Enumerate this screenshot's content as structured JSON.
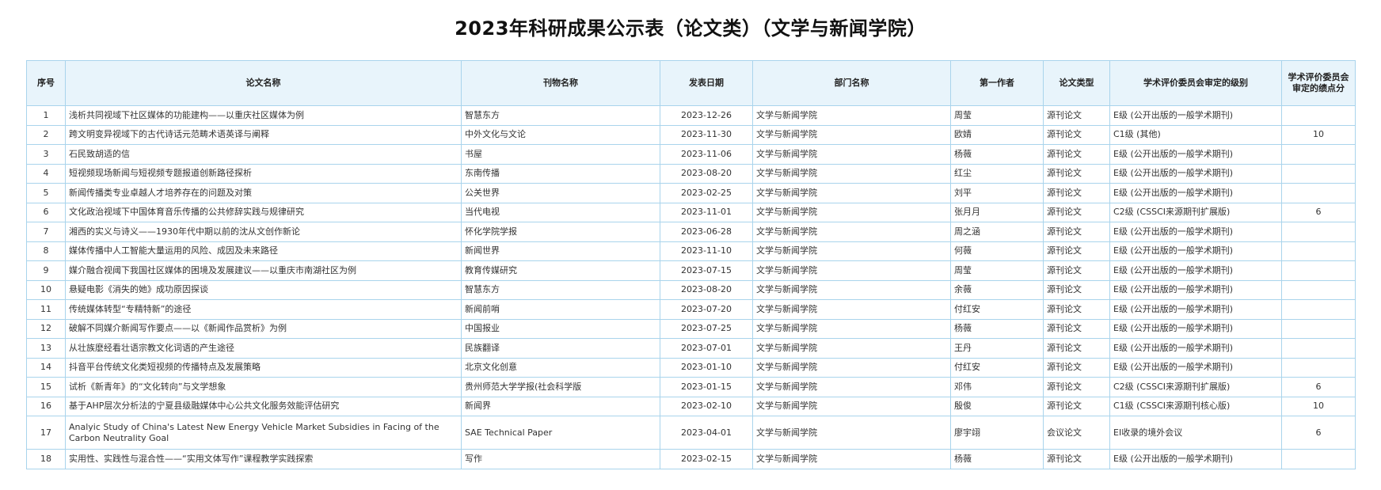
{
  "title": "2023年科研成果公示表（论文类）（文学与新闻学院）",
  "headers": [
    "序号",
    "论文名称",
    "刊物名称",
    "发表日期",
    "部门名称",
    "第一作者",
    "论文类型",
    "学术评价委员会审定的级别",
    "学术评价委员会审定的绩点分"
  ],
  "rows": [
    {
      "no": "1",
      "name": "浅析共同视域下社区媒体的功能建构——以重庆社区媒体为例",
      "journal": "智慧东方",
      "date": "2023-12-26",
      "dept": "文学与新闻学院",
      "author": "周莹",
      "type": "源刊论文",
      "level": "E级 (公开出版的一般学术期刊)",
      "score": ""
    },
    {
      "no": "2",
      "name": "跨文明变异视域下的古代诗话元范畴术语英译与阐释",
      "journal": "中外文化与文论",
      "date": "2023-11-30",
      "dept": "文学与新闻学院",
      "author": "欧婧",
      "type": "源刊论文",
      "level": "C1级 (其他)",
      "score": "10"
    },
    {
      "no": "3",
      "name": "石民致胡适的信",
      "journal": "书屋",
      "date": "2023-11-06",
      "dept": "文学与新闻学院",
      "author": "杨薇",
      "type": "源刊论文",
      "level": "E级 (公开出版的一般学术期刊)",
      "score": ""
    },
    {
      "no": "4",
      "name": "短视频现场新闻与短视频专题报道创新路径探析",
      "journal": "东南传播",
      "date": "2023-08-20",
      "dept": "文学与新闻学院",
      "author": "红尘",
      "type": "源刊论文",
      "level": "E级 (公开出版的一般学术期刊)",
      "score": ""
    },
    {
      "no": "5",
      "name": "新闻传播类专业卓越人才培养存在的问题及对策",
      "journal": "公关世界",
      "date": "2023-02-25",
      "dept": "文学与新闻学院",
      "author": "刘平",
      "type": "源刊论文",
      "level": "E级 (公开出版的一般学术期刊)",
      "score": ""
    },
    {
      "no": "6",
      "name": "文化政治视域下中国体育音乐传播的公共修辞实践与规律研究",
      "journal": "当代电视",
      "date": "2023-11-01",
      "dept": "文学与新闻学院",
      "author": "张月月",
      "type": "源刊论文",
      "level": "C2级 (CSSCI来源期刊扩展版)",
      "score": "6"
    },
    {
      "no": "7",
      "name": "湘西的实义与诗义——1930年代中期以前的沈从文创作新论",
      "journal": "怀化学院学报",
      "date": "2023-06-28",
      "dept": "文学与新闻学院",
      "author": "周之涵",
      "type": "源刊论文",
      "level": "E级 (公开出版的一般学术期刊)",
      "score": ""
    },
    {
      "no": "8",
      "name": "媒体传播中人工智能大量运用的风险、成因及未来路径",
      "journal": "新闻世界",
      "date": "2023-11-10",
      "dept": "文学与新闻学院",
      "author": "何薇",
      "type": "源刊论文",
      "level": "E级 (公开出版的一般学术期刊)",
      "score": ""
    },
    {
      "no": "9",
      "name": "媒介融合视阈下我国社区媒体的困境及发展建议——以重庆市南湖社区为例",
      "journal": "教育传媒研究",
      "date": "2023-07-15",
      "dept": "文学与新闻学院",
      "author": "周莹",
      "type": "源刊论文",
      "level": "E级 (公开出版的一般学术期刊)",
      "score": ""
    },
    {
      "no": "10",
      "name": "悬疑电影《消失的她》成功原因探谈",
      "journal": "智慧东方",
      "date": "2023-08-20",
      "dept": "文学与新闻学院",
      "author": "余薇",
      "type": "源刊论文",
      "level": "E级 (公开出版的一般学术期刊)",
      "score": ""
    },
    {
      "no": "11",
      "name": "传统媒体转型“专精特新”的途径",
      "journal": "新闻前哨",
      "date": "2023-07-20",
      "dept": "文学与新闻学院",
      "author": "付红安",
      "type": "源刊论文",
      "level": "E级 (公开出版的一般学术期刊)",
      "score": ""
    },
    {
      "no": "12",
      "name": "破解不同媒介新闻写作要点——以《新闻作品赏析》为例",
      "journal": "中国报业",
      "date": "2023-07-25",
      "dept": "文学与新闻学院",
      "author": "杨薇",
      "type": "源刊论文",
      "level": "E级 (公开出版的一般学术期刊)",
      "score": ""
    },
    {
      "no": "13",
      "name": "从壮族麽经看壮语宗教文化词语的产生途径",
      "journal": "民族翻译",
      "date": "2023-07-01",
      "dept": "文学与新闻学院",
      "author": "王丹",
      "type": "源刊论文",
      "level": "E级 (公开出版的一般学术期刊)",
      "score": ""
    },
    {
      "no": "14",
      "name": "抖音平台传统文化类短视频的传播特点及发展策略",
      "journal": "北京文化创意",
      "date": "2023-01-10",
      "dept": "文学与新闻学院",
      "author": "付红安",
      "type": "源刊论文",
      "level": "E级 (公开出版的一般学术期刊)",
      "score": ""
    },
    {
      "no": "15",
      "name": "试析《新青年》的“文化转向”与文学想象",
      "journal": "贵州师范大学学报(社会科学版",
      "date": "2023-01-15",
      "dept": "文学与新闻学院",
      "author": "邓伟",
      "type": "源刊论文",
      "level": "C2级 (CSSCI来源期刊扩展版)",
      "score": "6"
    },
    {
      "no": "16",
      "name": "基于AHP层次分析法的宁夏县级融媒体中心公共文化服务效能评估研究",
      "journal": "新闻界",
      "date": "2023-02-10",
      "dept": "文学与新闻学院",
      "author": "殷俊",
      "type": "源刊论文",
      "level": "C1级 (CSSCI来源期刊核心版)",
      "score": "10"
    },
    {
      "no": "17",
      "name": "Analyic Study of China's Latest New Energy Vehicle Market Subsidies in Facing of the Carbon Neutrality Goal",
      "journal": "SAE Technical Paper",
      "date": "2023-04-01",
      "dept": "文学与新闻学院",
      "author": "廖宇翊",
      "type": "会议论文",
      "level": "EI收录的境外会议",
      "score": "6"
    },
    {
      "no": "18",
      "name": "实用性、实践性与混合性——“实用文体写作”课程教学实践探索",
      "journal": "写作",
      "date": "2023-02-15",
      "dept": "文学与新闻学院",
      "author": "杨薇",
      "type": "源刊论文",
      "level": "E级 (公开出版的一般学术期刊)",
      "score": ""
    }
  ]
}
